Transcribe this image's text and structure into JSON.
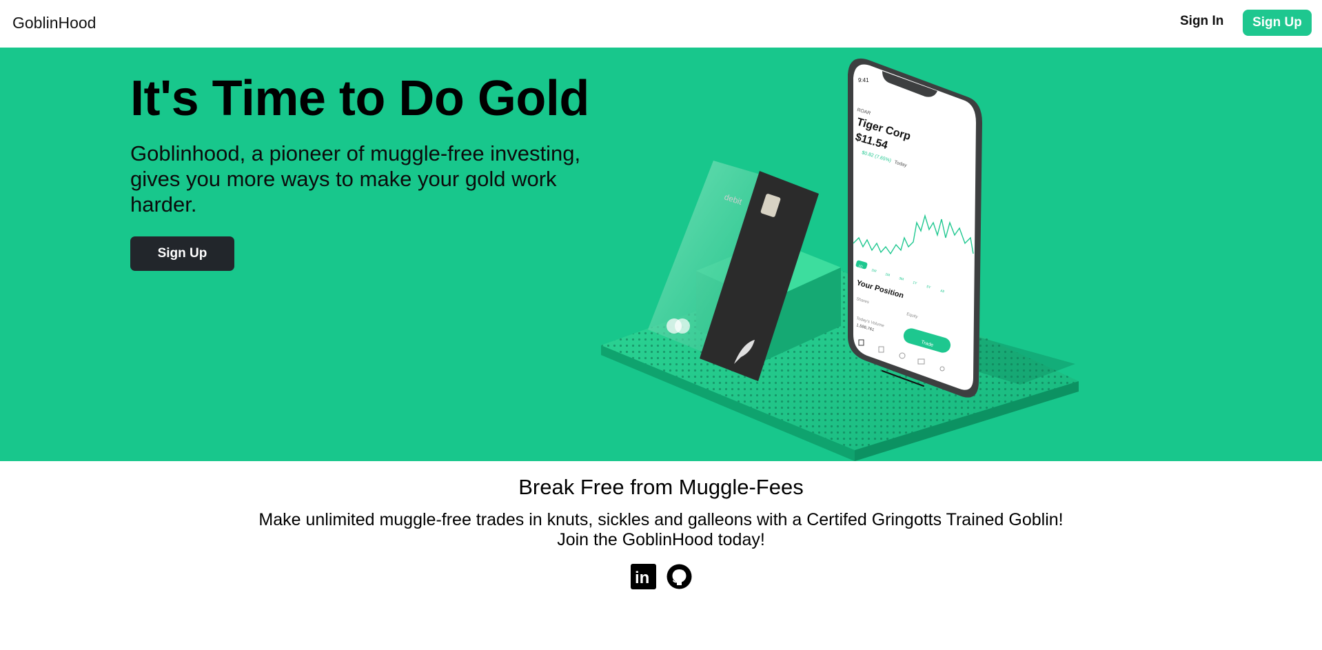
{
  "nav": {
    "brand": "GoblinHood",
    "sign_in_label": "Sign In",
    "sign_up_label": "Sign Up"
  },
  "hero": {
    "title": "It's Time to Do Gold",
    "subtitle": "Goblinhood, a pioneer of muggle-free investing, gives you more ways to make your gold work harder.",
    "cta_label": "Sign Up",
    "illustration": {
      "card_label": "debit",
      "phone": {
        "time": "9:41",
        "ticker": "ROAR",
        "company": "Tiger Corp",
        "price": "$11.54",
        "change": "$0.82 (7.65%)",
        "change_period": "Today",
        "ranges": [
          "1D",
          "1W",
          "1M",
          "3M",
          "1Y",
          "5Y",
          "All"
        ],
        "position_heading": "Your Position",
        "shares_label": "Shares",
        "equity_label": "Equity",
        "volume_label": "Today's Volume",
        "volume_value": "1,586,761",
        "trade_label": "Trade"
      }
    }
  },
  "section": {
    "title": "Break Free from Muggle-Fees",
    "line1": "Make unlimited muggle-free trades in knuts, sickles and galleons with a Certifed Gringotts Trained Goblin!",
    "line2": "Join the GoblinHood today!"
  },
  "socials": [
    {
      "icon": "linkedin-icon",
      "label": "in"
    },
    {
      "icon": "github-icon"
    }
  ],
  "colors": {
    "brand_green": "#18c78c",
    "button_green": "#1ec78f",
    "dark_button": "#22262b"
  }
}
